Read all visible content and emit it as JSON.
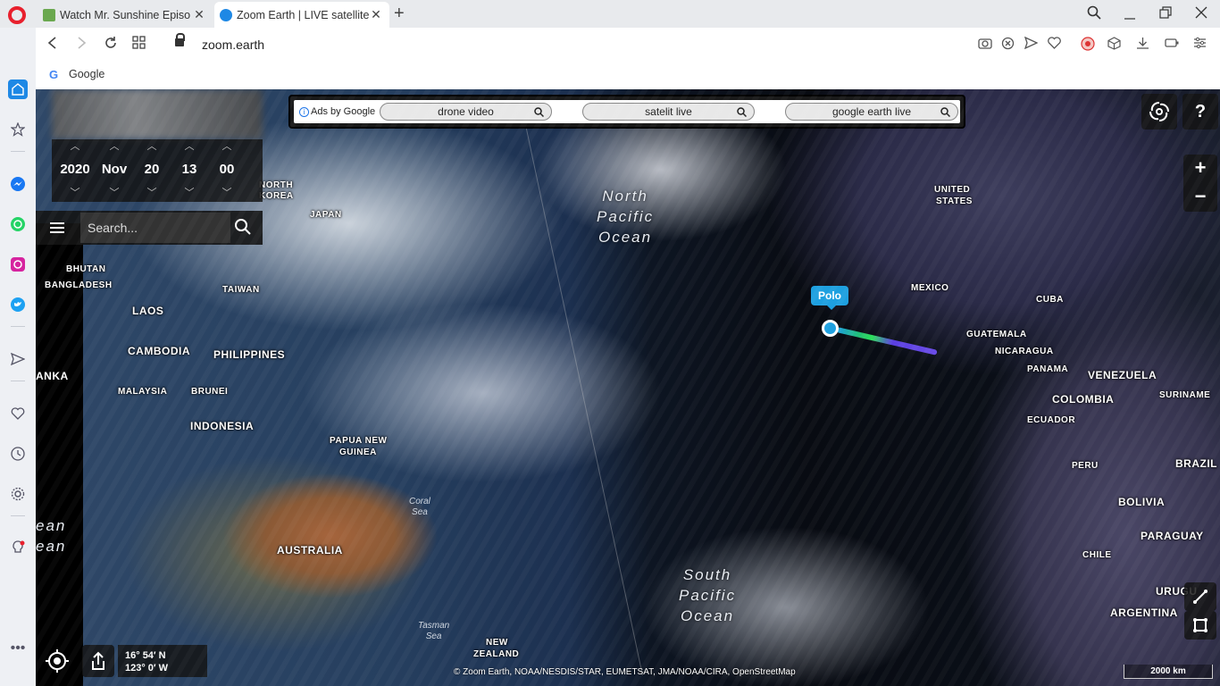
{
  "browser": {
    "tabs": [
      {
        "label": "Watch Mr. Sunshine Episo",
        "close": "✕",
        "fav_color": "#6aa84f"
      },
      {
        "label": "Zoom Earth | LIVE satellite",
        "close": "✕",
        "fav_color": "#1e88e5"
      }
    ],
    "new_tab": "+",
    "url": "zoom.earth",
    "bookmarks": [
      {
        "icon": "G",
        "label": "Google"
      }
    ]
  },
  "map": {
    "datetime": {
      "year": "2020",
      "month": "Nov",
      "day": "20",
      "hour": "13",
      "minute": "00"
    },
    "search_placeholder": "Search...",
    "ads": {
      "label": "Ads by Google",
      "pills": [
        "drone video",
        "satelit live",
        "google earth live"
      ]
    },
    "help": "?",
    "zoom_in": "+",
    "zoom_out": "−",
    "storm": {
      "name": "Polo"
    },
    "oceans": {
      "north_pacific": [
        "North",
        "Pacific",
        "Ocean"
      ],
      "south_pacific": [
        "South",
        "Pacific",
        "Ocean"
      ],
      "cut_left_1": "ean",
      "cut_left_2": "ean"
    },
    "seas": {
      "coral": [
        "Coral",
        "Sea"
      ],
      "tasman": [
        "Tasman",
        "Sea"
      ]
    },
    "labels": {
      "north": "NORTH",
      "korea": "KOREA",
      "japan": "JAPAN",
      "bhutan": "BHUTAN",
      "bangladesh": "BANGLADESH",
      "taiwan": "TAIWAN",
      "laos": "LAOS",
      "cambodia": "CAMBODIA",
      "philippines": "PHILIPPINES",
      "malaysia": "MALAYSIA",
      "brunei": "BRUNEI",
      "indonesia": "INDONESIA",
      "papua": "PAPUA NEW",
      "guinea": "GUINEA",
      "australia": "AUSTRALIA",
      "new": "NEW",
      "zealand": "ZEALAND",
      "anka": "ANKA",
      "united": "UNITED",
      "states": "STATES",
      "mexico": "MEXICO",
      "cuba": "CUBA",
      "guatemala": "GUATEMALA",
      "nicaragua": "NICARAGUA",
      "panama": "PANAMA",
      "venezuela": "VENEZUELA",
      "colombia": "COLOMBIA",
      "suriname": "SURINAME",
      "ecuador": "ECUADOR",
      "peru": "PERU",
      "brazil": "BRAZIL",
      "bolivia": "BOLIVIA",
      "paraguay": "PARAGUAY",
      "chile": "CHILE",
      "uruguay": "URUGU",
      "argentina": "ARGENTINA"
    },
    "coords": {
      "lat": "16° 54′ N",
      "lon": "123° 0′ W"
    },
    "attribution": "© Zoom Earth, NOAA/NESDIS/STAR, EUMETSAT, JMA/NOAA/CIRA, OpenStreetMap",
    "scale": "2000 km"
  }
}
